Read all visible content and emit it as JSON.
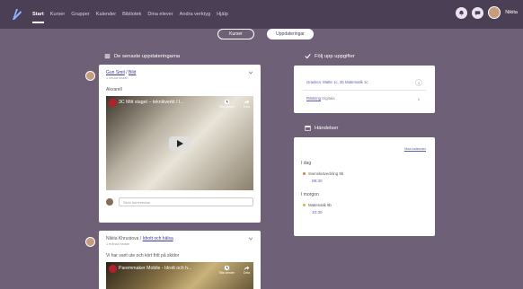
{
  "topbar": {
    "nav": [
      "Start",
      "Kurser",
      "Grupper",
      "Kalender",
      "Bibliotek",
      "Dina elever",
      "Andra verktyg",
      "Hjälp"
    ],
    "username": "Nikita"
  },
  "pills": {
    "courses": "Kurser",
    "updates": "Uppdateringar"
  },
  "sections": {
    "latest": "De senaste uppdateringarna",
    "tasks": "Följ upp uppgifter",
    "events": "Händelser"
  },
  "feed": [
    {
      "author_link": "Gun Smit",
      "author_sep": " / ",
      "group_link": "Bild",
      "time": "1 vecka sedan",
      "text": "Akvarell",
      "video_title": "3C Mitt staget – teknikverkt / I...",
      "video_actions": [
        "Titta senare",
        "Dela"
      ],
      "comment_placeholder": "Skriv kommentar"
    },
    {
      "author_plain": "Nikita Khrustova",
      "author_sep": " / ",
      "group_link": "Idrott och hälsa",
      "time": "1 månad sedan",
      "text": "Vi har varit ute och kört fritt på skidor",
      "video_title": "Paremmaker Mobile - Idrott och h...",
      "video_actions": [
        "Titta senare",
        "Dela"
      ]
    }
  ],
  "tasks": [
    {
      "label": "Gradera: Matte 1c, 2b Matematik 1c",
      "count": "1"
    },
    {
      "label": "Rättning",
      "extra": "Digitala",
      "count": "1"
    }
  ],
  "events": {
    "link": "Visa kalender",
    "days": [
      {
        "label": "I dag",
        "item": "Svenskutveckling 9b",
        "time": "08:30",
        "color": "#e8734a"
      },
      {
        "label": "I morgon",
        "item": "Matematik 9b",
        "time": "10:30",
        "color": "#e8a84a"
      }
    ]
  },
  "colors": {
    "accent": "#5b5fb5",
    "topbar": "#4a3f55",
    "background": "#6e6177"
  }
}
